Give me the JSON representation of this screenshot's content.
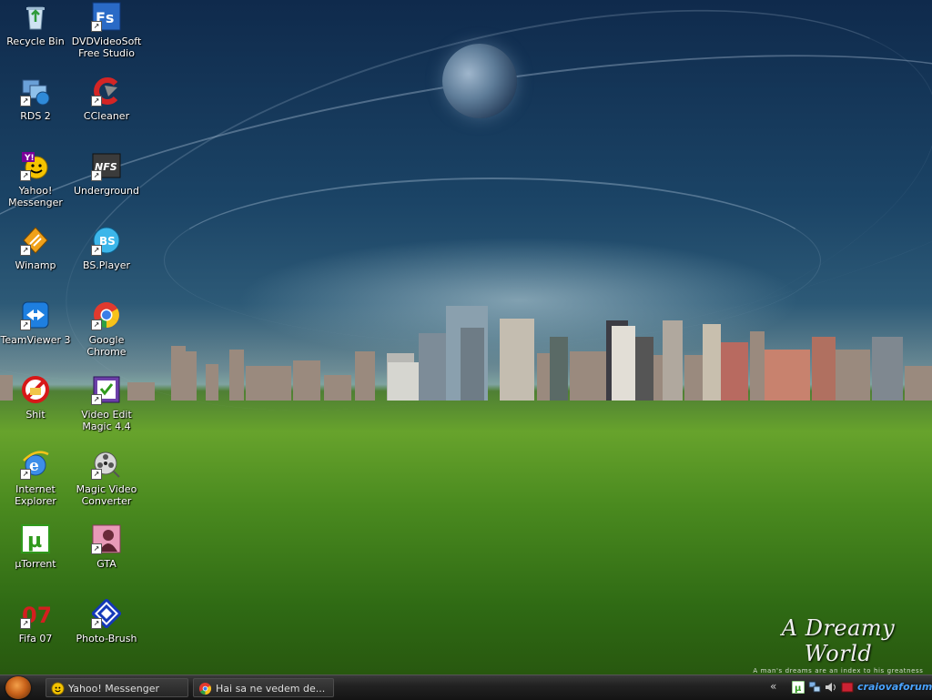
{
  "desktop": {
    "icons": [
      {
        "label": "Recycle Bin",
        "icon": "recycle-bin-icon",
        "shortcut": false
      },
      {
        "label": "DVDVideoSoft\nFree Studio",
        "icon": "fs-icon",
        "shortcut": true
      },
      {
        "label": "RDS 2",
        "icon": "rds-icon",
        "shortcut": true
      },
      {
        "label": "CCleaner",
        "icon": "ccleaner-icon",
        "shortcut": true
      },
      {
        "label": "Yahoo!\nMessenger",
        "icon": "yahoo-messenger-icon",
        "shortcut": true
      },
      {
        "label": "Underground",
        "icon": "nfs-icon",
        "shortcut": true
      },
      {
        "label": "Winamp",
        "icon": "winamp-icon",
        "shortcut": true
      },
      {
        "label": "BS.Player",
        "icon": "bsplayer-icon",
        "shortcut": true
      },
      {
        "label": "TeamViewer 3",
        "icon": "teamviewer-icon",
        "shortcut": true
      },
      {
        "label": "Google Chrome",
        "icon": "chrome-icon",
        "shortcut": true
      },
      {
        "label": "Shit",
        "icon": "forbidden-folder-icon",
        "shortcut": false
      },
      {
        "label": "Video Edit\nMagic 4.4",
        "icon": "video-edit-icon",
        "shortcut": true
      },
      {
        "label": "Internet\nExplorer",
        "icon": "ie-icon",
        "shortcut": true
      },
      {
        "label": "Magic Video\nConverter",
        "icon": "film-reel-icon",
        "shortcut": true
      },
      {
        "label": "µTorrent",
        "icon": "utorrent-icon",
        "shortcut": false
      },
      {
        "label": "GTA",
        "icon": "gta-icon",
        "shortcut": true
      },
      {
        "label": "Fifa 07",
        "icon": "fifa-icon",
        "shortcut": true
      },
      {
        "label": "Photo-Brush",
        "icon": "photobrush-icon",
        "shortcut": true
      }
    ]
  },
  "wallpaper": {
    "title": "A Dreamy World",
    "subtitle": "A man's dreams are an index to his greatness"
  },
  "taskbar": {
    "tasks": [
      {
        "label": "Yahoo! Messenger",
        "icon": "yahoo-messenger-icon"
      },
      {
        "label": "Hai sa ne vedem de...",
        "icon": "chrome-icon"
      }
    ],
    "tray": {
      "chevron": "«",
      "text": "craiovaforum.ro"
    }
  },
  "colors": {
    "taskbar": "#1e1e1e",
    "tray_link": "#4aa3ff",
    "grass": "#5c9a26",
    "sky": "#1b4466"
  }
}
